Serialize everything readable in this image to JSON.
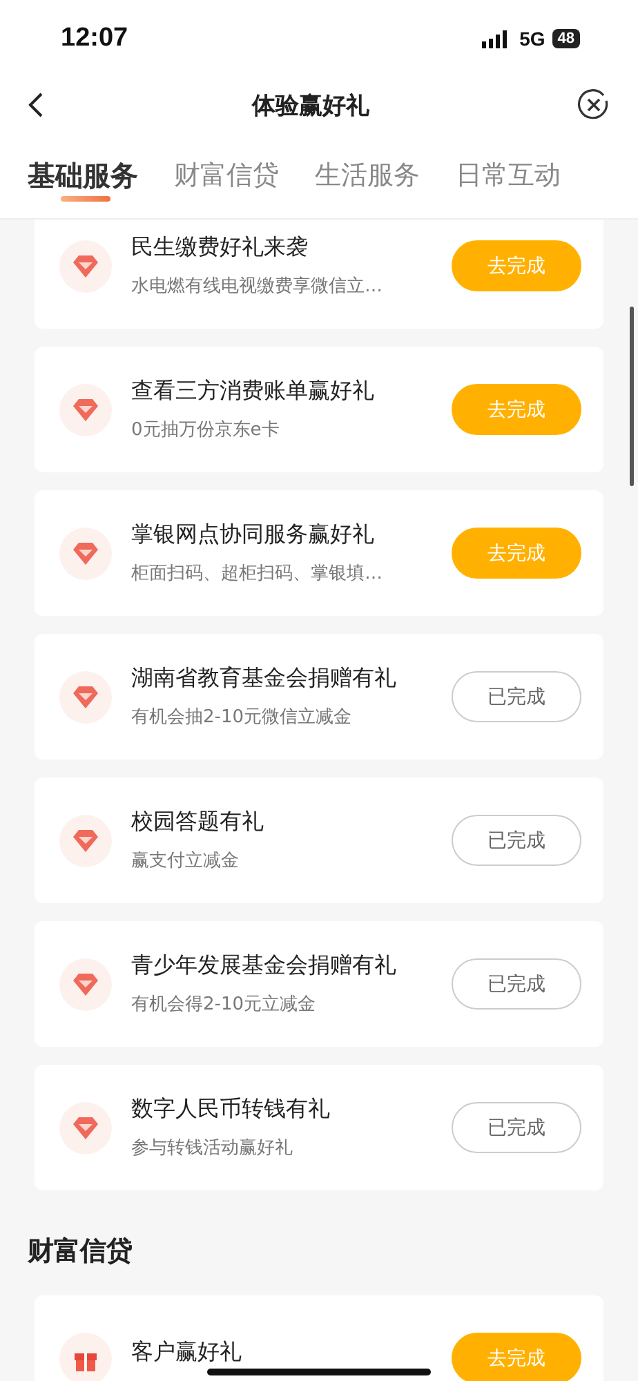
{
  "status_bar": {
    "time": "12:07",
    "network": "5G",
    "battery": "48"
  },
  "nav": {
    "title": "体验赢好礼"
  },
  "tabs": [
    {
      "label": "基础服务",
      "selected": true
    },
    {
      "label": "财富信贷",
      "selected": false
    },
    {
      "label": "生活服务",
      "selected": false
    },
    {
      "label": "日常互动",
      "selected": false
    }
  ],
  "sections": [
    {
      "tasks": [
        {
          "title": "民生缴费好礼来袭",
          "subtitle": "水电燃有线电视缴费享微信立…",
          "button": "去完成",
          "done": false,
          "kind": "gem"
        },
        {
          "title": "查看三方消费账单赢好礼",
          "subtitle": "0元抽万份京东e卡",
          "button": "去完成",
          "done": false,
          "kind": "gem"
        },
        {
          "title": "掌银网点协同服务赢好礼",
          "subtitle": "柜面扫码、超柜扫码、掌银填…",
          "button": "去完成",
          "done": false,
          "kind": "gem"
        },
        {
          "title": "湖南省教育基金会捐赠有礼",
          "subtitle": "有机会抽2-10元微信立减金",
          "button": "已完成",
          "done": true,
          "kind": "gem"
        },
        {
          "title": "校园答题有礼",
          "subtitle": "赢支付立减金",
          "button": "已完成",
          "done": true,
          "kind": "gem"
        },
        {
          "title": "青少年发展基金会捐赠有礼",
          "subtitle": "有机会得2-10元立减金",
          "button": "已完成",
          "done": true,
          "kind": "gem"
        },
        {
          "title": "数字人民币转钱有礼",
          "subtitle": "参与转钱活动赢好礼",
          "button": "已完成",
          "done": true,
          "kind": "gem"
        }
      ]
    },
    {
      "heading": "财富信贷",
      "tasks": [
        {
          "title": "客户赢好礼",
          "button": "去完成",
          "done": false,
          "kind": "gift"
        }
      ]
    }
  ]
}
